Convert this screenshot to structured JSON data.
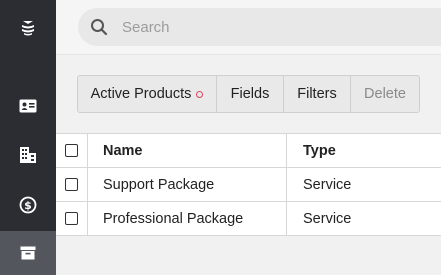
{
  "sidebar": {
    "logo": "app-logo",
    "items": [
      {
        "icon": "contacts-card-icon",
        "active": false
      },
      {
        "icon": "buildings-icon",
        "active": false
      },
      {
        "icon": "dollar-circle-icon",
        "active": false
      },
      {
        "icon": "archive-box-icon",
        "active": true
      }
    ]
  },
  "search": {
    "placeholder": "Search"
  },
  "toolbar": {
    "active_products_label": "Active Products",
    "fields_label": "Fields",
    "filters_label": "Filters",
    "delete_label": "Delete",
    "filter_dot_color": "#e0455e"
  },
  "table": {
    "columns": [
      "Name",
      "Type"
    ],
    "rows": [
      {
        "name": "Support Package",
        "type": "Service"
      },
      {
        "name": "Professional Package",
        "type": "Service"
      }
    ]
  }
}
